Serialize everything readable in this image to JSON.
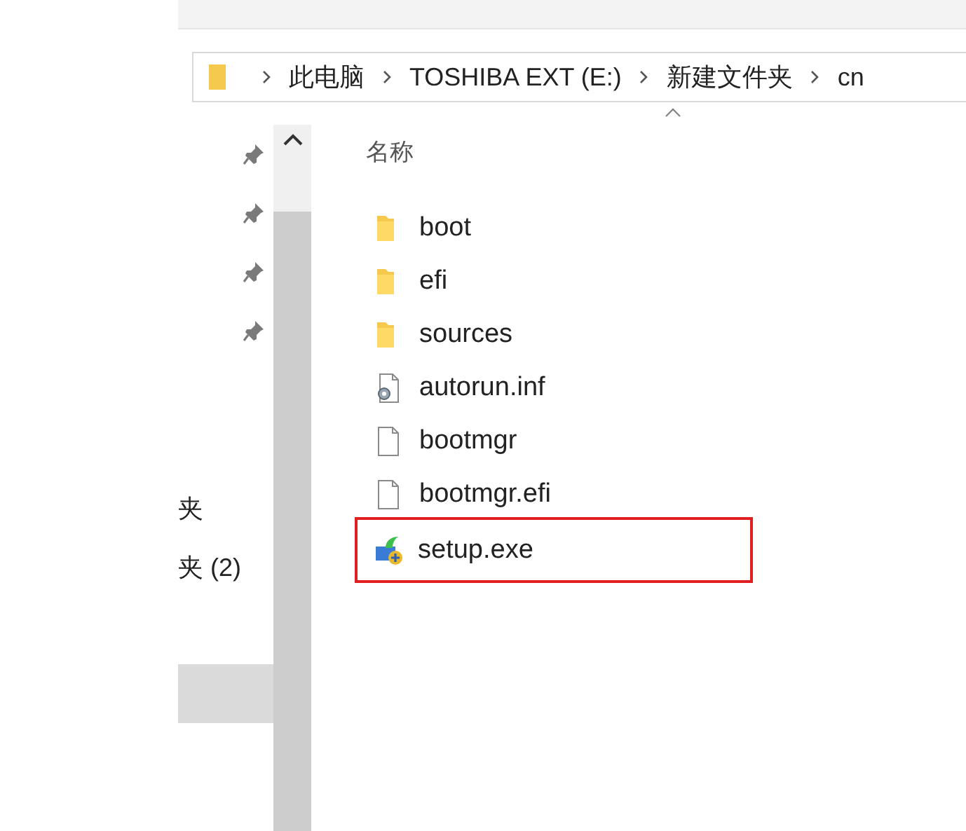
{
  "breadcrumb": [
    {
      "label": "此电脑"
    },
    {
      "label": "TOSHIBA EXT (E:)"
    },
    {
      "label": "新建文件夹"
    },
    {
      "label": "cn"
    }
  ],
  "quick_access": [
    {
      "pinned": true
    },
    {
      "pinned": true
    },
    {
      "pinned": true
    },
    {
      "pinned": true
    }
  ],
  "nav_items": [
    {
      "label": "夹",
      "selected": false
    },
    {
      "label": "夹 (2)",
      "selected": false
    },
    {
      "selected": true
    }
  ],
  "column_header": {
    "label": "名称",
    "sorted": true
  },
  "files": [
    {
      "name": "boot",
      "kind": "folder",
      "highlighted": false
    },
    {
      "name": "efi",
      "kind": "folder",
      "highlighted": false
    },
    {
      "name": "sources",
      "kind": "folder",
      "highlighted": false
    },
    {
      "name": "autorun.inf",
      "kind": "settings",
      "highlighted": false
    },
    {
      "name": "bootmgr",
      "kind": "file",
      "highlighted": false
    },
    {
      "name": "bootmgr.efi",
      "kind": "file",
      "highlighted": false
    },
    {
      "name": "setup.exe",
      "kind": "program",
      "highlighted": true
    }
  ]
}
